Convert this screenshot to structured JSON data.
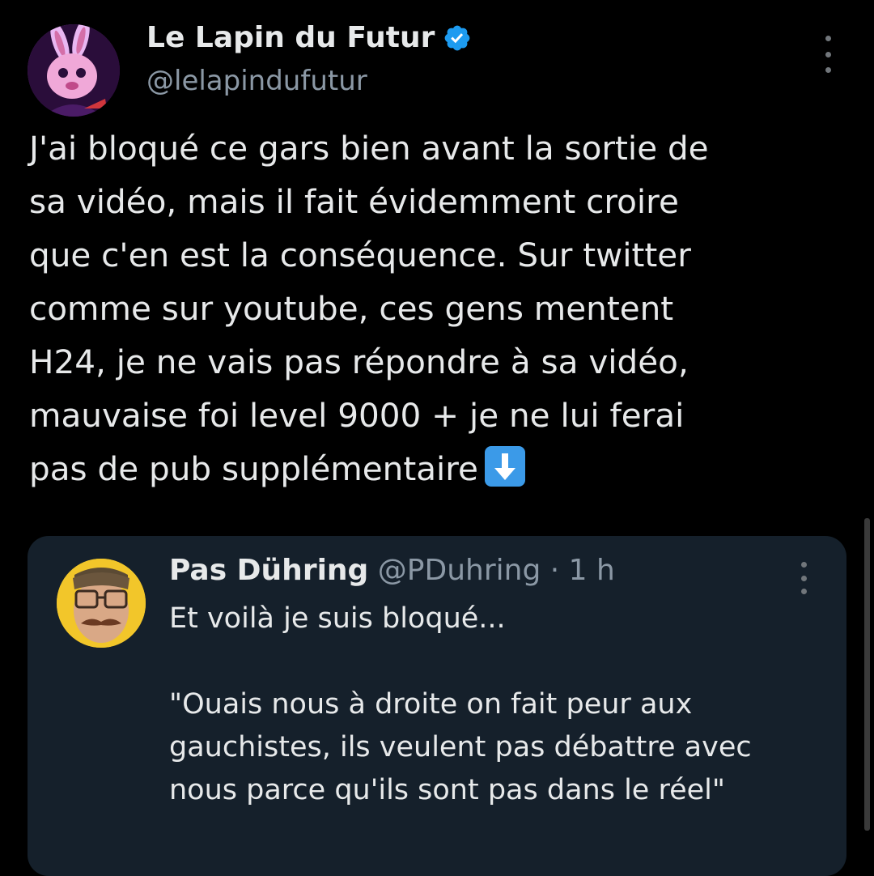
{
  "tweet": {
    "author": {
      "display_name": "Le Lapin du Futur",
      "handle": "@lelapindufutur",
      "verified": true
    },
    "text_lines": [
      "J'ai bloqué ce gars bien avant la sortie de",
      "sa vidéo, mais il fait évidemment croire",
      "que c'en est la conséquence. Sur twitter",
      "comme sur youtube, ces gens mentent",
      "H24, je ne vais pas répondre à sa vidéo,",
      "mauvaise foi level 9000 + je ne lui ferai",
      "pas de pub supplémentaire"
    ],
    "emoji": "down-arrow-emoji"
  },
  "quoted_tweet": {
    "author": {
      "display_name": "Pas Dühring",
      "handle": "@PDuhring",
      "time": "1 h",
      "separator": "·"
    },
    "text_lines": [
      "Et voilà je suis bloqué...",
      "",
      "\"Ouais nous à droite on fait peur aux",
      "gauchistes, ils veulent pas débattre avec",
      "nous parce qu'ils sont pas dans le réel\""
    ]
  },
  "icons": {
    "verified": "verified-badge-icon",
    "more": "more-options-icon"
  },
  "colors": {
    "background": "#000000",
    "text": "#e7e9ea",
    "secondary_text": "#8b98a5",
    "verified": "#1d9bf0",
    "quote_background": "#15202b"
  }
}
